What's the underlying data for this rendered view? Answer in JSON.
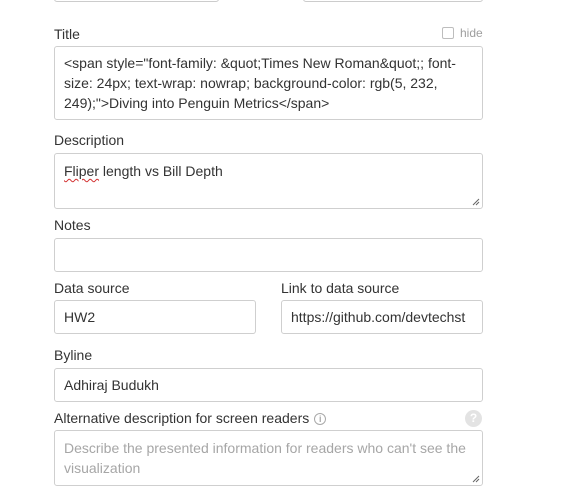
{
  "title": {
    "label": "Title",
    "hide_label": "hide",
    "value": "<span style=\"font-family: &quot;Times New Roman&quot;; font-size: 24px; text-wrap: nowrap; background-color: rgb(5, 232, 249);\">Diving into Penguin Metrics</span>"
  },
  "description": {
    "label": "Description",
    "value_misspelled": "Fliper",
    "value_rest": " length vs Bill Depth"
  },
  "notes": {
    "label": "Notes",
    "value": ""
  },
  "data_source": {
    "label": "Data source",
    "value": "HW2"
  },
  "link_to_data_source": {
    "label": "Link to data source",
    "value": "https://github.com/devtechst"
  },
  "byline": {
    "label": "Byline",
    "value": "Adhiraj Budukh"
  },
  "alt_description": {
    "label": "Alternative description for screen readers",
    "info_icon": "i",
    "help_icon": "?",
    "placeholder": "Describe the presented information for readers who can't see the visualization"
  }
}
